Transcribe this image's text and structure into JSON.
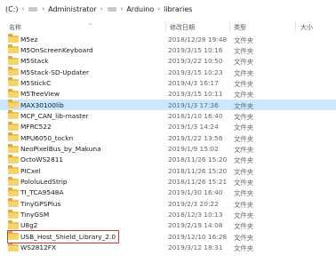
{
  "breadcrumb": {
    "drive": "(C:)",
    "sep": "›",
    "items": [
      "Administrator",
      "Arduino",
      "libraries"
    ]
  },
  "header": {
    "name": "名称",
    "date": "修改日期",
    "type": "类型",
    "size": "大小"
  },
  "files": [
    {
      "name": "M5ez",
      "date": "2018/12/28 19:48",
      "type": "文件夹"
    },
    {
      "name": "M5OnScreenKeyboard",
      "date": "2019/3/15 10:16",
      "type": "文件夹"
    },
    {
      "name": "M5Stack",
      "date": "2019/3/22 10:50",
      "type": "文件夹"
    },
    {
      "name": "M5Stack-SD-Updater",
      "date": "2019/3/15 10:23",
      "type": "文件夹"
    },
    {
      "name": "M5StickC",
      "date": "2019/4/3 16:17",
      "type": "文件夹"
    },
    {
      "name": "M5TreeView",
      "date": "2019/3/15 10:11",
      "type": "文件夹"
    },
    {
      "name": "MAX30100lib",
      "date": "2019/1/3 17:36",
      "type": "文件夹"
    },
    {
      "name": "MCP_CAN_lib-master",
      "date": "2018/1/10 16:40",
      "type": "文件夹"
    },
    {
      "name": "MFRC522",
      "date": "2019/1/3 14:24",
      "type": "文件夹"
    },
    {
      "name": "MPU6050_tockn",
      "date": "2019/1/22 13:56",
      "type": "文件夹"
    },
    {
      "name": "NeoPixelBus_by_Makuna",
      "date": "2019/1/9 15:02",
      "type": "文件夹"
    },
    {
      "name": "OctoWS2811",
      "date": "2018/11/26 15:20",
      "type": "文件夹"
    },
    {
      "name": "PICxel",
      "date": "2018/11/26 15:20",
      "type": "文件夹"
    },
    {
      "name": "PololuLedStrip",
      "date": "2018/11/26 15:21",
      "type": "文件夹"
    },
    {
      "name": "TI_TCA9548A",
      "date": "2019/1/30 16:40",
      "type": "文件夹"
    },
    {
      "name": "TinyGPSPlus",
      "date": "2019/2/3 20:22",
      "type": "文件夹"
    },
    {
      "name": "TinyGSM",
      "date": "2018/12/3 10:13",
      "type": "文件夹"
    },
    {
      "name": "U8g2",
      "date": "2019/2/19 14:08",
      "type": "文件夹"
    },
    {
      "name": "USB_Host_Shield_Library_2.0",
      "date": "2019/12/10 16:28",
      "type": "文件夹"
    },
    {
      "name": "WS2812FX",
      "date": "2019/3/12 18:31",
      "type": "文件夹"
    }
  ],
  "selected_index": 6,
  "highlighted_index": 18,
  "colors": {
    "selection": "#cce8ff",
    "highlight_border": "#c93a3a",
    "folder": "#f2c14e"
  }
}
